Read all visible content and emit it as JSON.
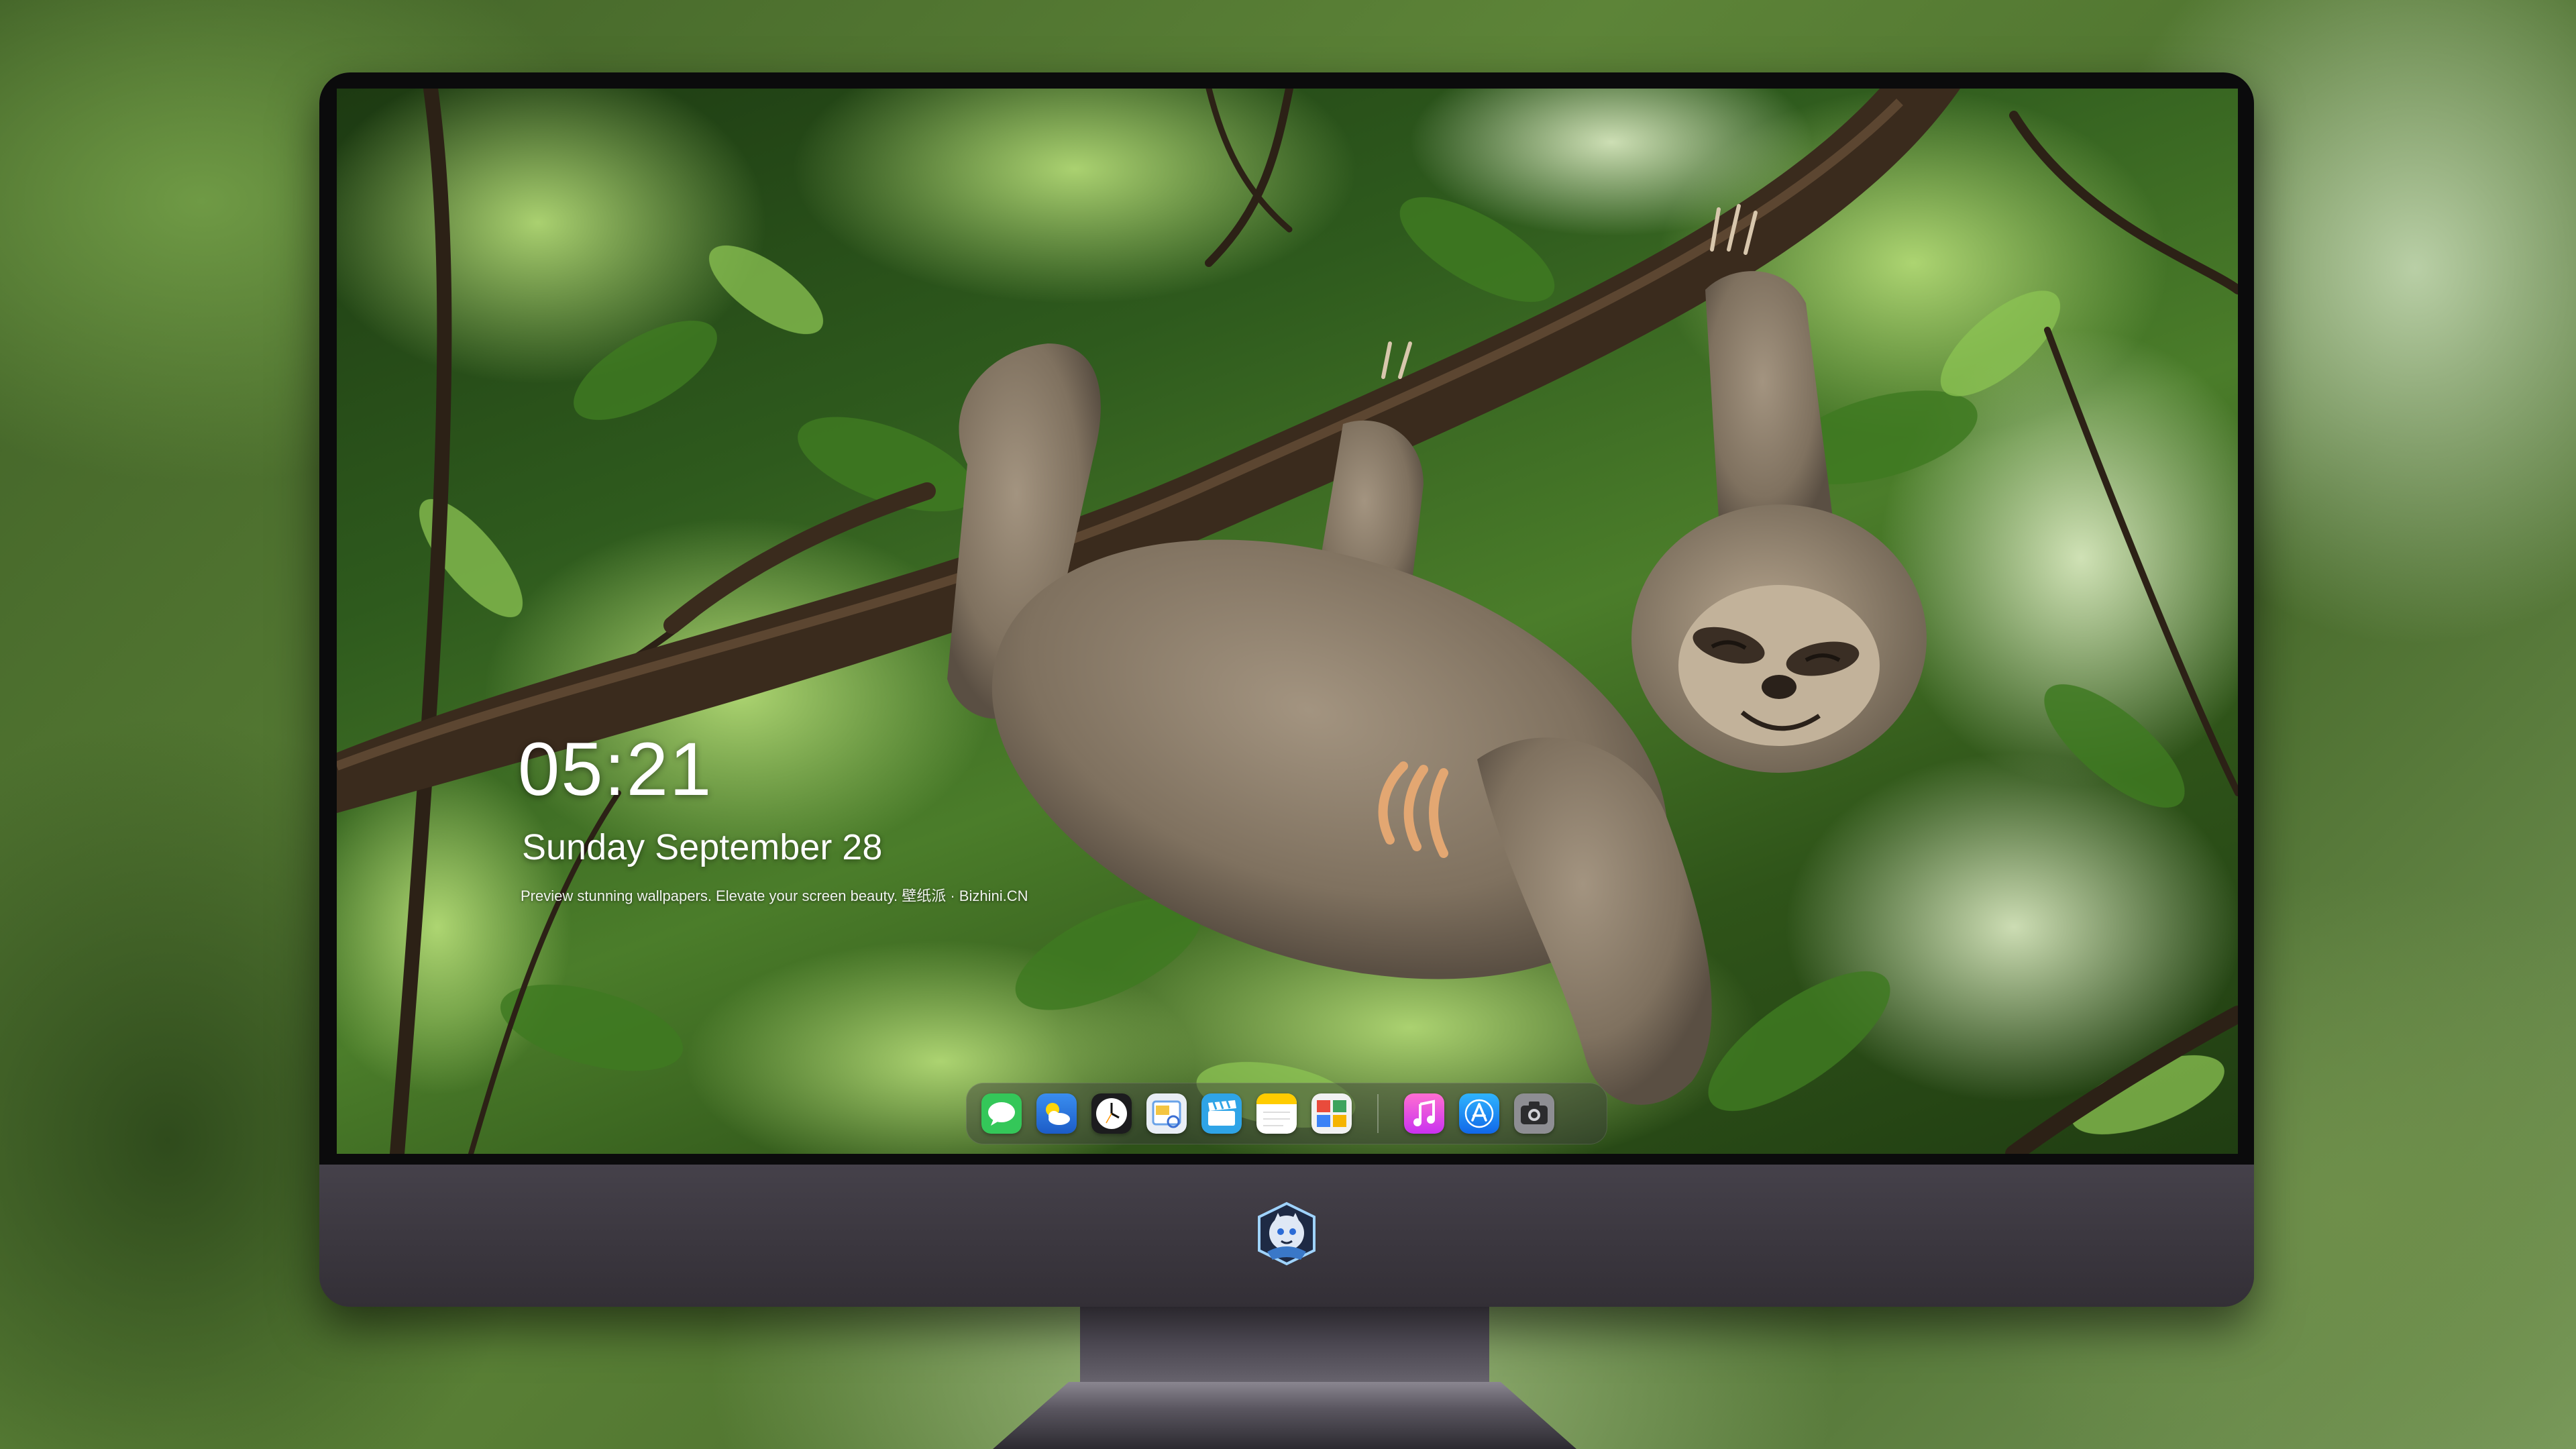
{
  "lock_screen": {
    "time": "05:21",
    "date": "Sunday September  28",
    "caption": "Preview stunning wallpapers. Elevate your screen beauty. 壁纸派 · Bizhini.CN"
  },
  "dock": {
    "apps": [
      {
        "name": "Messages",
        "icon": "messages-icon"
      },
      {
        "name": "Weather",
        "icon": "weather-icon"
      },
      {
        "name": "Clock",
        "icon": "clock-icon"
      },
      {
        "name": "Preview",
        "icon": "preview-icon"
      },
      {
        "name": "Clips",
        "icon": "clips-icon"
      },
      {
        "name": "Notes",
        "icon": "notes-icon"
      },
      {
        "name": "Photo Booth",
        "icon": "photo-booth-icon"
      },
      {
        "name": "Music",
        "icon": "music-icon"
      },
      {
        "name": "App Store",
        "icon": "app-store-icon"
      },
      {
        "name": "Screenshot",
        "icon": "camera-icon"
      }
    ]
  },
  "monitor": {
    "logo_icon": "character-badge-icon"
  },
  "colors": {
    "bezel": "#0b0b0c",
    "chin": "#3f3b43",
    "foliage_dark": "#2e5a1d",
    "foliage_light": "#9ccf62",
    "sloth_fur": "#8a7c6a"
  }
}
